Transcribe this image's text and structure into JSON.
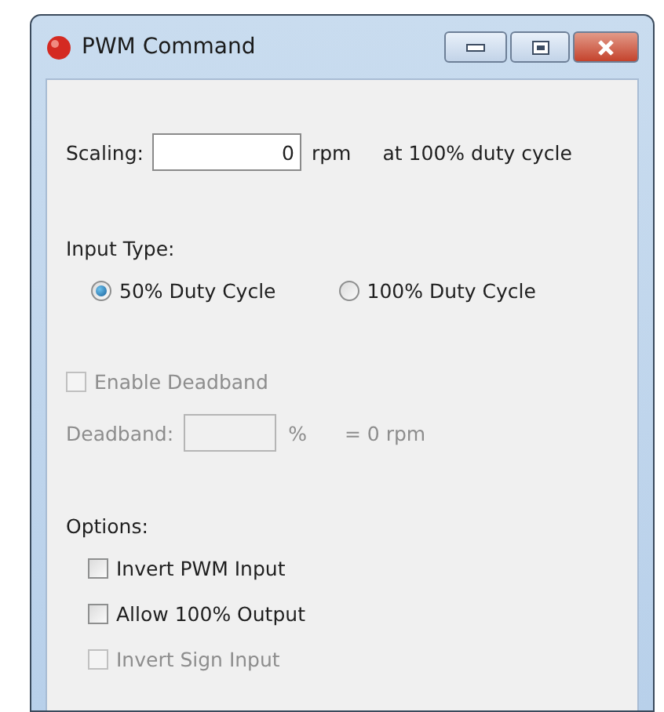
{
  "window": {
    "title": "PWM Command"
  },
  "scaling": {
    "label": "Scaling:",
    "value": "0",
    "unit": "rpm",
    "note": "at 100% duty cycle"
  },
  "input_type": {
    "label": "Input Type:",
    "options": [
      {
        "label": "50% Duty Cycle",
        "selected": true
      },
      {
        "label": "100% Duty Cycle",
        "selected": false
      }
    ]
  },
  "enable_deadband": {
    "label": "Enable Deadband",
    "checked": false,
    "disabled": true
  },
  "deadband": {
    "label": "Deadband:",
    "unit": "%",
    "result": "= 0 rpm",
    "disabled": true
  },
  "options": {
    "label": "Options:",
    "items": [
      {
        "label": "Invert PWM Input",
        "checked": false,
        "disabled": false
      },
      {
        "label": "Allow 100% Output",
        "checked": false,
        "disabled": false
      },
      {
        "label": "Invert Sign Input",
        "checked": false,
        "disabled": true
      }
    ]
  }
}
